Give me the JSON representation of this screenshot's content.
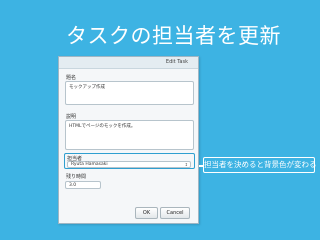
{
  "slide": {
    "title": "タスクの担当者を更新"
  },
  "dialog": {
    "title": "Edit Task",
    "name": {
      "label": "題名",
      "value": "モックアップ作成"
    },
    "description": {
      "label": "説明",
      "value": "HTMLでページのモックを作成。"
    },
    "assignee": {
      "label": "担当者",
      "value": "Ryuta Hamasaki",
      "arrow": "↕"
    },
    "remaining": {
      "label": "残り時間",
      "value": "3.0"
    },
    "ok_label": "OK",
    "cancel_label": "Cancel"
  },
  "callout": {
    "text": "担当者を決めると背景色が変わる"
  },
  "colors": {
    "background": "#3db3e3",
    "highlight": "#2f9fd0"
  }
}
